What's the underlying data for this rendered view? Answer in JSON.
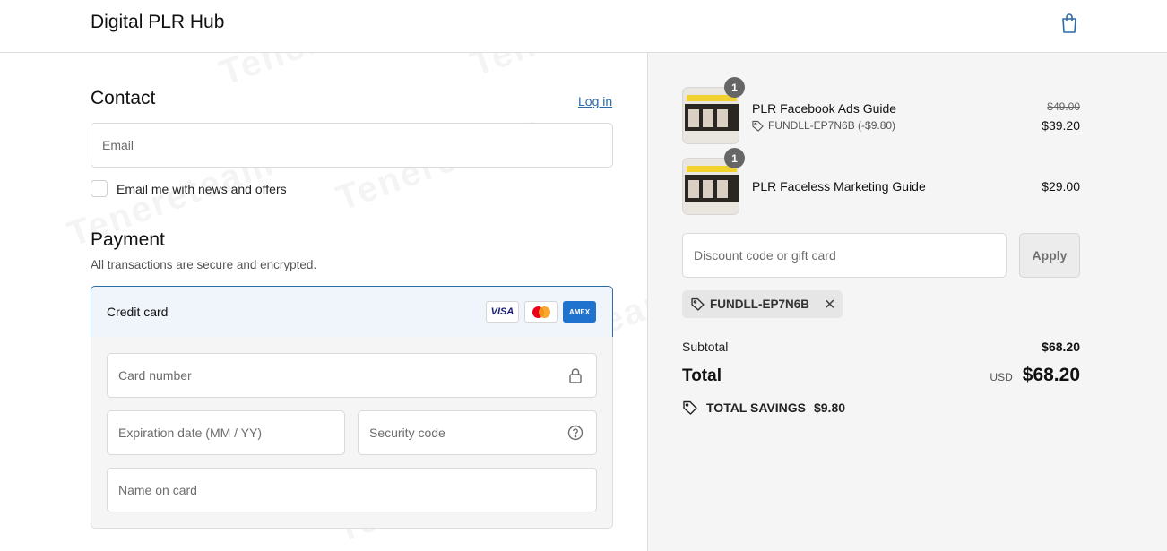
{
  "header": {
    "brand": "Digital PLR Hub"
  },
  "contact": {
    "title": "Contact",
    "login": "Log in",
    "email_placeholder": "Email",
    "newsletter": "Email me with news and offers"
  },
  "payment": {
    "title": "Payment",
    "subtitle": "All transactions are secure and encrypted.",
    "method": "Credit card",
    "logos": {
      "visa": "VISA",
      "amex": "AMEX"
    },
    "card_number_placeholder": "Card number",
    "expiry_placeholder": "Expiration date (MM / YY)",
    "security_placeholder": "Security code",
    "name_placeholder": "Name on card"
  },
  "cart": {
    "items": [
      {
        "qty": "1",
        "name": "PLR Facebook Ads Guide",
        "discount": "FUNDLL-EP7N6B (-$9.80)",
        "old_price": "$49.00",
        "price": "$39.20"
      },
      {
        "qty": "1",
        "name": "PLR Faceless Marketing Guide",
        "price": "$29.00"
      }
    ],
    "discount_placeholder": "Discount code or gift card",
    "apply": "Apply",
    "applied_code": "FUNDLL-EP7N6B",
    "subtotal_label": "Subtotal",
    "subtotal": "$68.20",
    "total_label": "Total",
    "currency": "USD",
    "total": "$68.20",
    "savings_label": "TOTAL SAVINGS",
    "savings": "$9.80"
  },
  "colors": {
    "accent": "#2d6aa8",
    "panel": "#f5f5f5"
  },
  "watermark": "Tenereteam"
}
